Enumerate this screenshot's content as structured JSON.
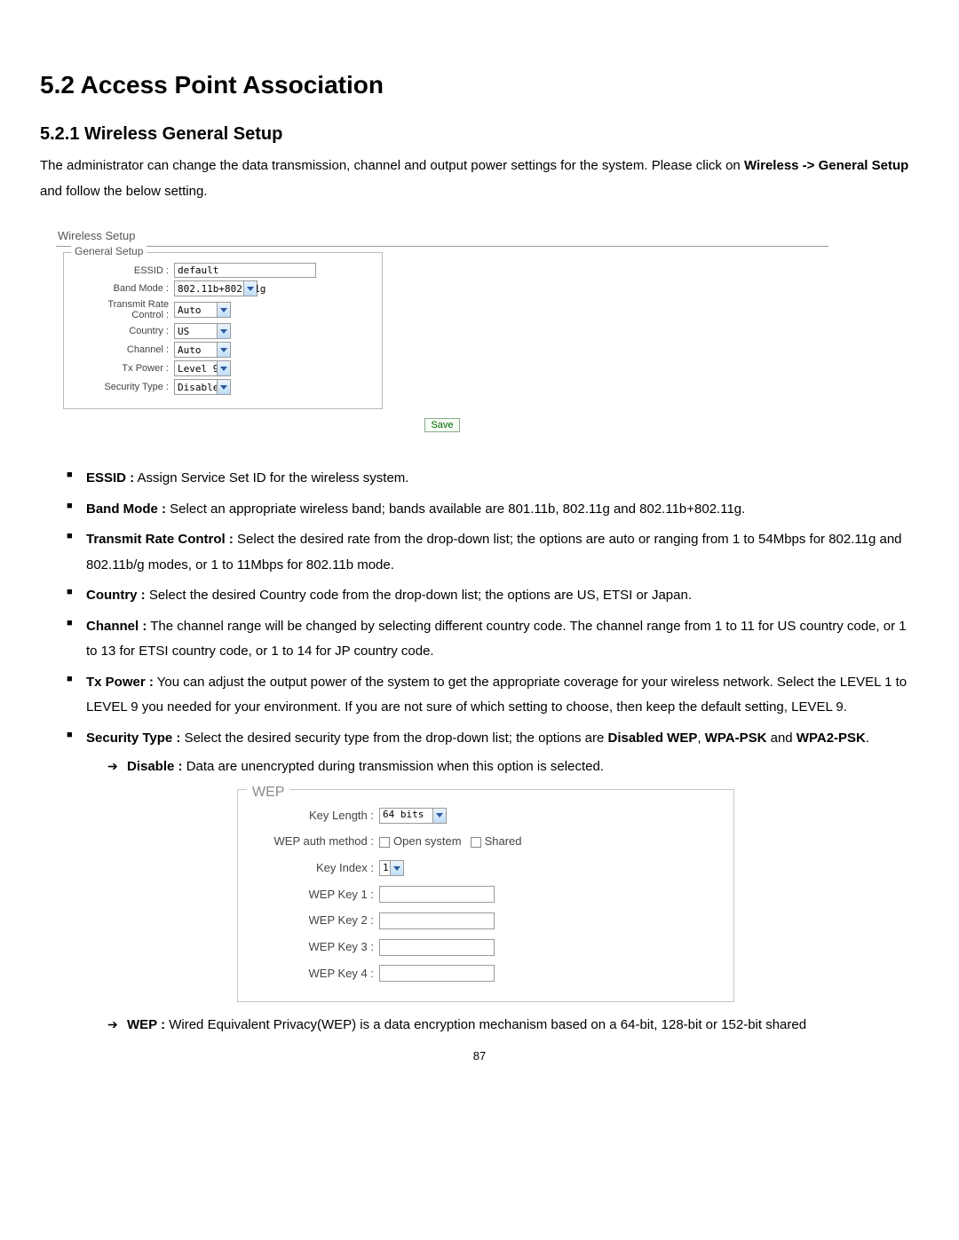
{
  "heading": "5.2 Access Point Association",
  "subheading": "5.2.1 Wireless General Setup",
  "intro_1": "The administrator can change the data transmission, channel and output power settings for the system. Please click on ",
  "intro_bold": "Wireless -> General Setup",
  "intro_2": " and follow the below setting.",
  "wireless_setup": {
    "panel_title": "Wireless Setup",
    "fieldset_title": "General Setup",
    "essid_label": "ESSID :",
    "essid_value": "default",
    "band_label": "Band Mode :",
    "band_value": "802.11b+802.11g",
    "rate_label": "Transmit Rate Control :",
    "rate_value": "Auto",
    "country_label": "Country :",
    "country_value": "US",
    "channel_label": "Channel :",
    "channel_value": "Auto",
    "tx_label": "Tx Power :",
    "tx_value": "Level 9",
    "sec_label": "Security Type :",
    "sec_value": "Disabled",
    "save_label": "Save"
  },
  "bullets": {
    "essid_b": "ESSID :",
    "essid_t": " Assign Service Set ID for the wireless system.",
    "band_b": "Band Mode :",
    "band_t": " Select an appropriate wireless band; bands available are 801.11b, 802.11g and 802.11b+802.11g.",
    "rate_b": "Transmit Rate Control :",
    "rate_t": " Select the desired rate from the drop-down list; the options are auto or ranging from 1 to 54Mbps for 802.11g and 802.11b/g modes, or 1 to 11Mbps for 802.11b mode.",
    "country_b": "Country :",
    "country_t": " Select the desired Country code from the drop-down list; the options are US, ETSI or Japan.",
    "channel_b": "Channel :",
    "channel_t": " The channel range will be changed by selecting different country code. The channel range from 1 to 11 for US country code, or 1 to 13 for ETSI country code, or 1 to 14 for JP country code.",
    "tx_b": "Tx Power :",
    "tx_t": " You can adjust the output power of the system to get the appropriate coverage for your wireless network. Select the LEVEL 1 to LEVEL 9  you needed for your environment. If you are not sure of which setting to choose, then keep the default setting, LEVEL 9.",
    "sec_b": "Security Type :",
    "sec_t1": " Select the desired security type from the drop-down list; the options are ",
    "sec_t_bold1": "Disabled WEP",
    "sec_t2": ", ",
    "sec_t_bold2": "WPA-PSK",
    "sec_t3": " and ",
    "sec_t_bold3": "WPA2-PSK",
    "sec_t4": ".",
    "disable_b": "Disable :",
    "disable_t": " Data are unencrypted during transmission when this option is selected.",
    "wep_b": "WEP :",
    "wep_t": " Wired Equivalent Privacy(WEP) is a data encryption mechanism based on a 64-bit, 128-bit or 152-bit shared"
  },
  "wep_panel": {
    "title": "WEP",
    "keylen_label": "Key Length :",
    "keylen_value": "64 bits",
    "auth_label": "WEP auth method :",
    "auth_open": "Open system",
    "auth_shared": "Shared",
    "keyidx_label": "Key Index :",
    "keyidx_value": "1",
    "k1_label": "WEP Key 1 :",
    "k2_label": "WEP Key 2 :",
    "k3_label": "WEP Key 3 :",
    "k4_label": "WEP Key 4 :"
  },
  "page_number": "87"
}
